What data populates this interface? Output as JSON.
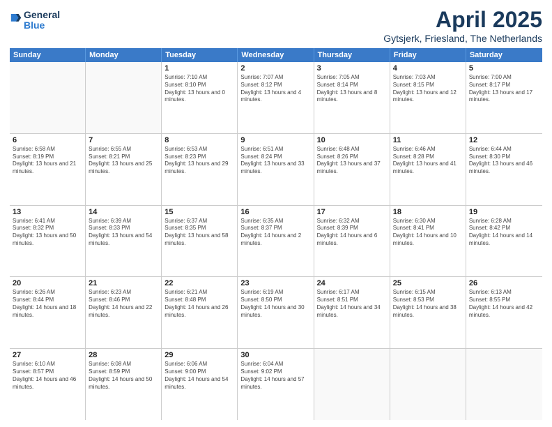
{
  "logo": {
    "general": "General",
    "blue": "Blue"
  },
  "title": "April 2025",
  "subtitle": "Gytsjerk, Friesland, The Netherlands",
  "header_days": [
    "Sunday",
    "Monday",
    "Tuesday",
    "Wednesday",
    "Thursday",
    "Friday",
    "Saturday"
  ],
  "weeks": [
    [
      {
        "day": "",
        "sunrise": "",
        "sunset": "",
        "daylight": ""
      },
      {
        "day": "",
        "sunrise": "",
        "sunset": "",
        "daylight": ""
      },
      {
        "day": "1",
        "sunrise": "Sunrise: 7:10 AM",
        "sunset": "Sunset: 8:10 PM",
        "daylight": "Daylight: 13 hours and 0 minutes."
      },
      {
        "day": "2",
        "sunrise": "Sunrise: 7:07 AM",
        "sunset": "Sunset: 8:12 PM",
        "daylight": "Daylight: 13 hours and 4 minutes."
      },
      {
        "day": "3",
        "sunrise": "Sunrise: 7:05 AM",
        "sunset": "Sunset: 8:14 PM",
        "daylight": "Daylight: 13 hours and 8 minutes."
      },
      {
        "day": "4",
        "sunrise": "Sunrise: 7:03 AM",
        "sunset": "Sunset: 8:15 PM",
        "daylight": "Daylight: 13 hours and 12 minutes."
      },
      {
        "day": "5",
        "sunrise": "Sunrise: 7:00 AM",
        "sunset": "Sunset: 8:17 PM",
        "daylight": "Daylight: 13 hours and 17 minutes."
      }
    ],
    [
      {
        "day": "6",
        "sunrise": "Sunrise: 6:58 AM",
        "sunset": "Sunset: 8:19 PM",
        "daylight": "Daylight: 13 hours and 21 minutes."
      },
      {
        "day": "7",
        "sunrise": "Sunrise: 6:55 AM",
        "sunset": "Sunset: 8:21 PM",
        "daylight": "Daylight: 13 hours and 25 minutes."
      },
      {
        "day": "8",
        "sunrise": "Sunrise: 6:53 AM",
        "sunset": "Sunset: 8:23 PM",
        "daylight": "Daylight: 13 hours and 29 minutes."
      },
      {
        "day": "9",
        "sunrise": "Sunrise: 6:51 AM",
        "sunset": "Sunset: 8:24 PM",
        "daylight": "Daylight: 13 hours and 33 minutes."
      },
      {
        "day": "10",
        "sunrise": "Sunrise: 6:48 AM",
        "sunset": "Sunset: 8:26 PM",
        "daylight": "Daylight: 13 hours and 37 minutes."
      },
      {
        "day": "11",
        "sunrise": "Sunrise: 6:46 AM",
        "sunset": "Sunset: 8:28 PM",
        "daylight": "Daylight: 13 hours and 41 minutes."
      },
      {
        "day": "12",
        "sunrise": "Sunrise: 6:44 AM",
        "sunset": "Sunset: 8:30 PM",
        "daylight": "Daylight: 13 hours and 46 minutes."
      }
    ],
    [
      {
        "day": "13",
        "sunrise": "Sunrise: 6:41 AM",
        "sunset": "Sunset: 8:32 PM",
        "daylight": "Daylight: 13 hours and 50 minutes."
      },
      {
        "day": "14",
        "sunrise": "Sunrise: 6:39 AM",
        "sunset": "Sunset: 8:33 PM",
        "daylight": "Daylight: 13 hours and 54 minutes."
      },
      {
        "day": "15",
        "sunrise": "Sunrise: 6:37 AM",
        "sunset": "Sunset: 8:35 PM",
        "daylight": "Daylight: 13 hours and 58 minutes."
      },
      {
        "day": "16",
        "sunrise": "Sunrise: 6:35 AM",
        "sunset": "Sunset: 8:37 PM",
        "daylight": "Daylight: 14 hours and 2 minutes."
      },
      {
        "day": "17",
        "sunrise": "Sunrise: 6:32 AM",
        "sunset": "Sunset: 8:39 PM",
        "daylight": "Daylight: 14 hours and 6 minutes."
      },
      {
        "day": "18",
        "sunrise": "Sunrise: 6:30 AM",
        "sunset": "Sunset: 8:41 PM",
        "daylight": "Daylight: 14 hours and 10 minutes."
      },
      {
        "day": "19",
        "sunrise": "Sunrise: 6:28 AM",
        "sunset": "Sunset: 8:42 PM",
        "daylight": "Daylight: 14 hours and 14 minutes."
      }
    ],
    [
      {
        "day": "20",
        "sunrise": "Sunrise: 6:26 AM",
        "sunset": "Sunset: 8:44 PM",
        "daylight": "Daylight: 14 hours and 18 minutes."
      },
      {
        "day": "21",
        "sunrise": "Sunrise: 6:23 AM",
        "sunset": "Sunset: 8:46 PM",
        "daylight": "Daylight: 14 hours and 22 minutes."
      },
      {
        "day": "22",
        "sunrise": "Sunrise: 6:21 AM",
        "sunset": "Sunset: 8:48 PM",
        "daylight": "Daylight: 14 hours and 26 minutes."
      },
      {
        "day": "23",
        "sunrise": "Sunrise: 6:19 AM",
        "sunset": "Sunset: 8:50 PM",
        "daylight": "Daylight: 14 hours and 30 minutes."
      },
      {
        "day": "24",
        "sunrise": "Sunrise: 6:17 AM",
        "sunset": "Sunset: 8:51 PM",
        "daylight": "Daylight: 14 hours and 34 minutes."
      },
      {
        "day": "25",
        "sunrise": "Sunrise: 6:15 AM",
        "sunset": "Sunset: 8:53 PM",
        "daylight": "Daylight: 14 hours and 38 minutes."
      },
      {
        "day": "26",
        "sunrise": "Sunrise: 6:13 AM",
        "sunset": "Sunset: 8:55 PM",
        "daylight": "Daylight: 14 hours and 42 minutes."
      }
    ],
    [
      {
        "day": "27",
        "sunrise": "Sunrise: 6:10 AM",
        "sunset": "Sunset: 8:57 PM",
        "daylight": "Daylight: 14 hours and 46 minutes."
      },
      {
        "day": "28",
        "sunrise": "Sunrise: 6:08 AM",
        "sunset": "Sunset: 8:59 PM",
        "daylight": "Daylight: 14 hours and 50 minutes."
      },
      {
        "day": "29",
        "sunrise": "Sunrise: 6:06 AM",
        "sunset": "Sunset: 9:00 PM",
        "daylight": "Daylight: 14 hours and 54 minutes."
      },
      {
        "day": "30",
        "sunrise": "Sunrise: 6:04 AM",
        "sunset": "Sunset: 9:02 PM",
        "daylight": "Daylight: 14 hours and 57 minutes."
      },
      {
        "day": "",
        "sunrise": "",
        "sunset": "",
        "daylight": ""
      },
      {
        "day": "",
        "sunrise": "",
        "sunset": "",
        "daylight": ""
      },
      {
        "day": "",
        "sunrise": "",
        "sunset": "",
        "daylight": ""
      }
    ]
  ]
}
